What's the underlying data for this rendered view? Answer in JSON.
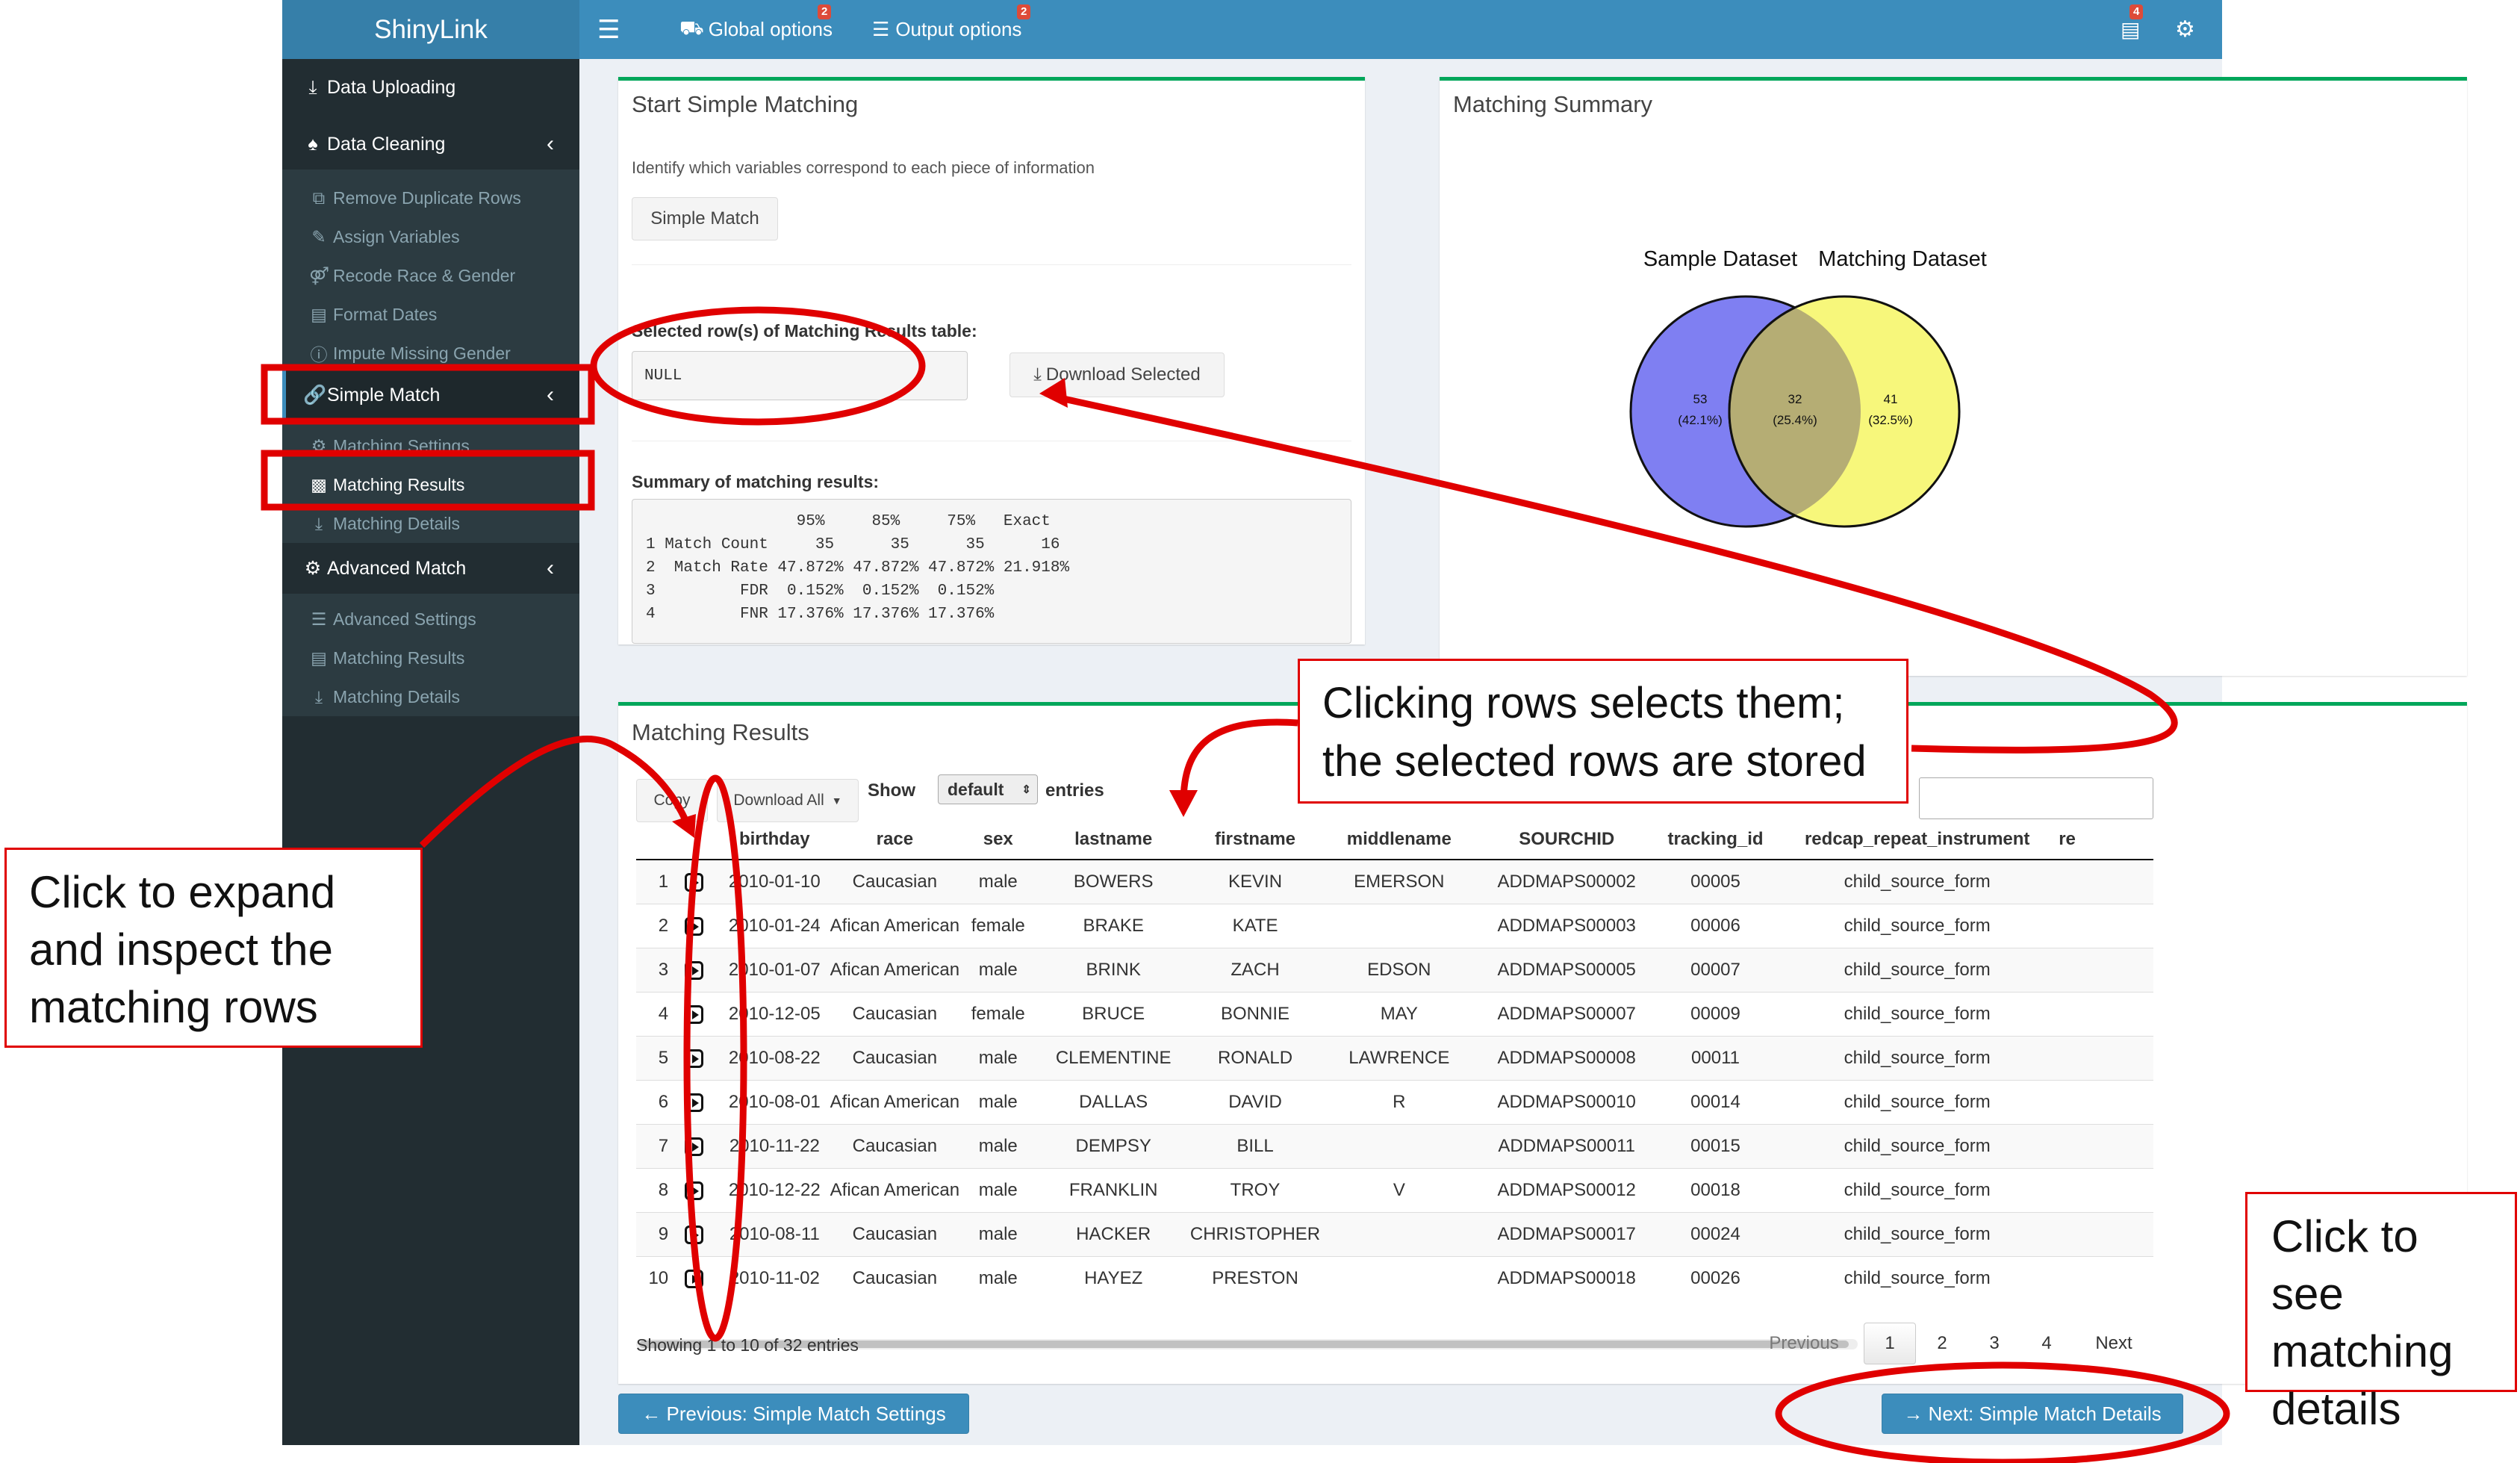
{
  "topbar": {
    "app_name": "ShinyLink",
    "menu_icon": "hamburger-icon",
    "global_options": "Global options",
    "global_badge": "2",
    "output_options": "Output options",
    "output_badge": "2",
    "tasks_badge": "4",
    "accent": "#3c8dbc"
  },
  "sidebar": {
    "data_uploading": "Data Uploading",
    "data_cleaning": "Data Cleaning",
    "cleaning_items": [
      "Remove Duplicate Rows",
      "Assign Variables",
      "Recode Race & Gender",
      "Format Dates",
      "Impute Missing Gender"
    ],
    "simple_match": "Simple Match",
    "simple_items": [
      "Matching Settings",
      "Matching Results",
      "Matching Details"
    ],
    "advanced_match": "Advanced Match",
    "advanced_items": [
      "Advanced Settings",
      "Matching Results",
      "Matching Details"
    ]
  },
  "start_box": {
    "title": "Start Simple Matching",
    "help_text": "Identify which variables correspond to each piece of information",
    "simple_match_button": "Simple Match",
    "selected_label": "Selected row(s) of Matching Results table:",
    "selected_value": "NULL",
    "download_selected": "Download Selected",
    "summary_label": "Summary of matching results:",
    "summary_text": "                95%     85%     75%   Exact\n1 Match Count     35      35      35      16\n2  Match Rate 47.872% 47.872% 47.872% 21.918%\n3         FDR  0.152%  0.152%  0.152%\n4         FNR 17.376% 17.376% 17.376%"
  },
  "summary_box": {
    "title": "Matching Summary",
    "venn": {
      "left_label": "Sample Dataset",
      "right_label": "Matching Dataset",
      "left_count": "53",
      "left_pct": "(42.1%)",
      "overlap_count": "32",
      "overlap_pct": "(25.4%)",
      "right_count": "41",
      "right_pct": "(32.5%)",
      "left_color": "#7f7ff2",
      "right_color": "#f7f77b",
      "overlap_color": "#b5ad74"
    }
  },
  "results_box": {
    "title": "Matching Results",
    "copy": "Copy",
    "download_all": "Download All",
    "show": "Show",
    "entries_select": "default",
    "entries": "entries",
    "columns": [
      "birthday",
      "race",
      "sex",
      "lastname",
      "firstname",
      "middlename",
      "SOURCHID",
      "tracking_id",
      "redcap_repeat_instrument",
      "re"
    ],
    "rows": [
      [
        "1",
        "2010-01-10",
        "Caucasian",
        "male",
        "BOWERS",
        "KEVIN",
        "EMERSON",
        "ADDMAPS00002",
        "00005",
        "child_source_form"
      ],
      [
        "2",
        "2010-01-24",
        "Afican American",
        "female",
        "BRAKE",
        "KATE",
        "",
        "ADDMAPS00003",
        "00006",
        "child_source_form"
      ],
      [
        "3",
        "2010-01-07",
        "Afican American",
        "male",
        "BRINK",
        "ZACH",
        "EDSON",
        "ADDMAPS00005",
        "00007",
        "child_source_form"
      ],
      [
        "4",
        "2010-12-05",
        "Caucasian",
        "female",
        "BRUCE",
        "BONNIE",
        "MAY",
        "ADDMAPS00007",
        "00009",
        "child_source_form"
      ],
      [
        "5",
        "2010-08-22",
        "Caucasian",
        "male",
        "CLEMENTINE",
        "RONALD",
        "LAWRENCE",
        "ADDMAPS00008",
        "00011",
        "child_source_form"
      ],
      [
        "6",
        "2010-08-01",
        "Afican American",
        "male",
        "DALLAS",
        "DAVID",
        "R",
        "ADDMAPS00010",
        "00014",
        "child_source_form"
      ],
      [
        "7",
        "2010-11-22",
        "Caucasian",
        "male",
        "DEMPSY",
        "BILL",
        "",
        "ADDMAPS00011",
        "00015",
        "child_source_form"
      ],
      [
        "8",
        "2010-12-22",
        "Afican American",
        "male",
        "FRANKLIN",
        "TROY",
        "V",
        "ADDMAPS00012",
        "00018",
        "child_source_form"
      ],
      [
        "9",
        "2010-08-11",
        "Caucasian",
        "male",
        "HACKER",
        "CHRISTOPHER",
        "",
        "ADDMAPS00017",
        "00024",
        "child_source_form"
      ],
      [
        "10",
        "2010-11-02",
        "Caucasian",
        "male",
        "HAYEZ",
        "PRESTON",
        "",
        "ADDMAPS00018",
        "00026",
        "child_source_form"
      ]
    ],
    "info": "Showing 1 to 10 of 32 entries",
    "pagination": {
      "previous": "Previous",
      "pages": [
        "1",
        "2",
        "3",
        "4"
      ],
      "next": "Next",
      "current": "1"
    }
  },
  "nav": {
    "previous": "← Previous: Simple Match Settings",
    "next": "→ Next: Simple Match Details"
  },
  "annotations": {
    "expand_note": "Click to expand and inspect the matching rows",
    "select_note": "Clicking rows selects them; the selected rows are stored",
    "details_note": "Click to see matching details",
    "annotation_color": "#e00000"
  }
}
